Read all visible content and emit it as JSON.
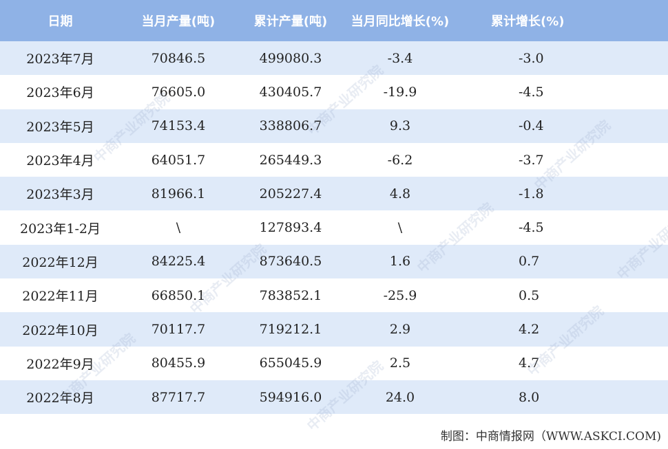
{
  "table": {
    "headers": [
      "日期",
      "当月产量(吨)",
      "累计产量(吨)",
      "当月同比增长(%)",
      "累计增长(%)"
    ],
    "rows": [
      [
        "2023年7月",
        "70846.5",
        "499080.3",
        "-3.4",
        "-3.0"
      ],
      [
        "2023年6月",
        "76605.0",
        "430405.7",
        "-19.9",
        "-4.5"
      ],
      [
        "2023年5月",
        "74153.4",
        "338806.7",
        "9.3",
        "-0.4"
      ],
      [
        "2023年4月",
        "64051.7",
        "265449.3",
        "-6.2",
        "-3.7"
      ],
      [
        "2023年3月",
        "81966.1",
        "205227.4",
        "4.8",
        "-1.8"
      ],
      [
        "2023年1-2月",
        "\\",
        "127893.4",
        "\\",
        "-4.5"
      ],
      [
        "2022年12月",
        "84225.4",
        "873640.5",
        "1.6",
        "0.7"
      ],
      [
        "2022年11月",
        "66850.1",
        "783852.1",
        "-25.9",
        "0.5"
      ],
      [
        "2022年10月",
        "70117.7",
        "719212.1",
        "2.9",
        "4.2"
      ],
      [
        "2022年9月",
        "80455.9",
        "655045.9",
        "2.5",
        "4.7"
      ],
      [
        "2022年8月",
        "87717.7",
        "594916.0",
        "24.0",
        "8.0"
      ]
    ]
  },
  "footer": {
    "credit": "制图：中商情报网（WWW.ASKCI.COM)"
  },
  "watermark": {
    "text": "中商产业研究院"
  },
  "colors": {
    "header_bg": "#8fb2e6",
    "row_shade": "#dfeaf9"
  }
}
